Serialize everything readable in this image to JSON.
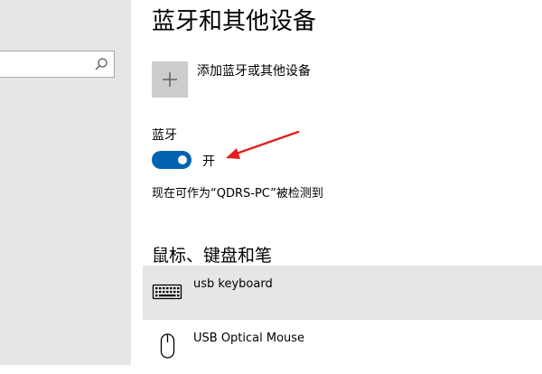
{
  "search": {
    "value": "",
    "placeholder": ""
  },
  "page": {
    "title": "蓝牙和其他设备",
    "add_device_label": "添加蓝牙或其他设备",
    "bluetooth": {
      "label": "蓝牙",
      "state": "开",
      "on": true,
      "discover_text": "现在可作为“QDRS-PC”被检测到"
    },
    "section_title": "鼠标、键盘和笔",
    "devices": [
      {
        "name": "usb keyboard",
        "icon": "keyboard-icon"
      },
      {
        "name": "USB Optical Mouse",
        "icon": "mouse-icon"
      }
    ]
  },
  "colors": {
    "accent": "#0063b1",
    "sidebar_bg": "#e6e6e6",
    "annotation_arrow": "#e02020"
  }
}
